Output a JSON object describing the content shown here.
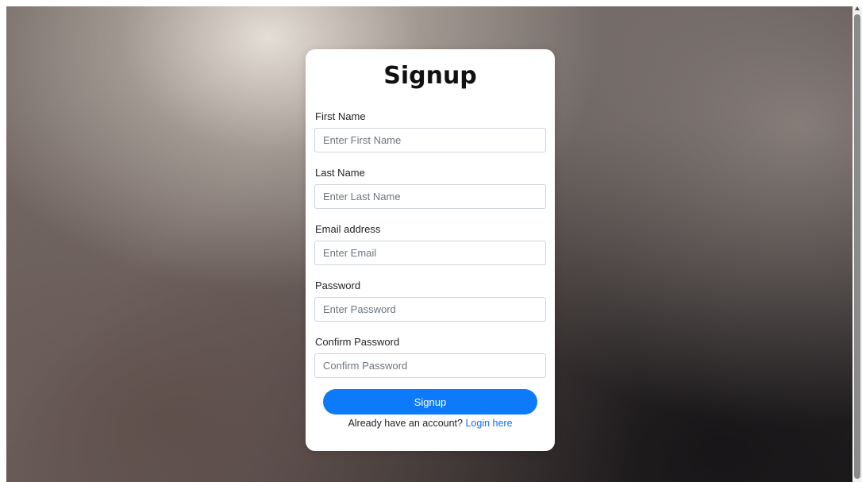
{
  "form": {
    "title": "Signup",
    "fields": [
      {
        "label": "First Name",
        "placeholder": "Enter First Name",
        "value": ""
      },
      {
        "label": "Last Name",
        "placeholder": "Enter Last Name",
        "value": ""
      },
      {
        "label": "Email address",
        "placeholder": "Enter Email",
        "value": ""
      },
      {
        "label": "Password",
        "placeholder": "Enter Password",
        "value": ""
      },
      {
        "label": "Confirm Password",
        "placeholder": "Confirm Password",
        "value": ""
      }
    ],
    "submit_label": "Signup",
    "footer_text": "Already have an account?",
    "login_link": "Login here"
  },
  "colors": {
    "accent": "#0d7bf9",
    "link": "#0d6efd",
    "card": "#ffffff"
  }
}
